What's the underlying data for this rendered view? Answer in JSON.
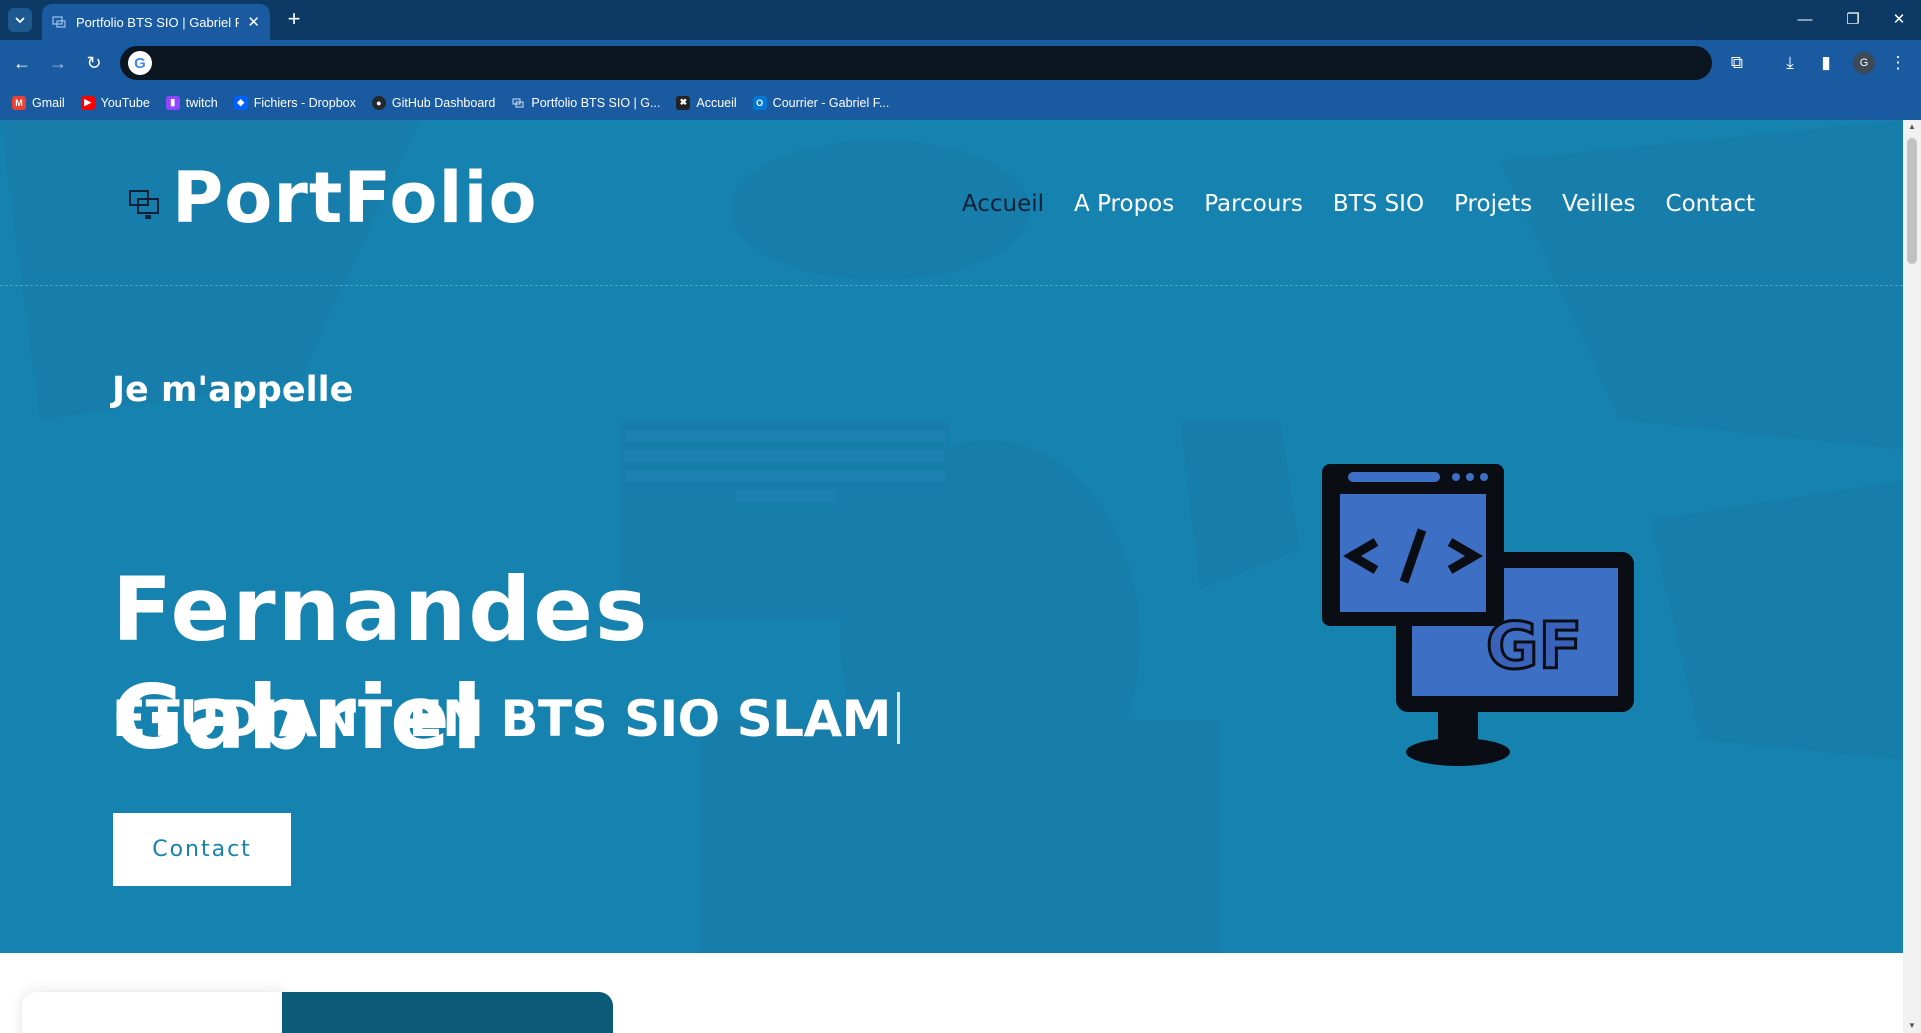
{
  "browser": {
    "tab_title": "Portfolio BTS SIO | Gabriel Fernandes",
    "new_tab": "+",
    "close_tab": "✕",
    "address": "",
    "profile_initial": "G",
    "bookmarks": [
      {
        "label": "Gmail",
        "icon": "gmail-icon",
        "color": "#ea4335"
      },
      {
        "label": "YouTube",
        "icon": "youtube-icon",
        "color": "#ff0000"
      },
      {
        "label": "twitch",
        "icon": "twitch-icon",
        "color": "#9146ff"
      },
      {
        "label": "Fichiers - Dropbox",
        "icon": "dropbox-icon",
        "color": "#0061fe"
      },
      {
        "label": "GitHub Dashboard",
        "icon": "github-icon",
        "color": "#24292f"
      },
      {
        "label": "Portfolio BTS SIO | G...",
        "icon": "portfolio-icon",
        "color": "#1a5aa0"
      },
      {
        "label": "Accueil",
        "icon": "accueil-icon",
        "color": "#222222"
      },
      {
        "label": "Courrier - Gabriel F...",
        "icon": "outlook-icon",
        "color": "#0078d4"
      }
    ]
  },
  "site": {
    "logo": "PortFolio",
    "nav": [
      "Accueil",
      "A Propos",
      "Parcours",
      "BTS SIO",
      "Projets",
      "Veilles",
      "Contact"
    ],
    "active_nav": "Accueil",
    "intro": "Je m'appelle",
    "name_line1": "Fernandes",
    "name_line2": "Gabriel",
    "role": "ÉTUDIANT EN BTS SIO SLAM",
    "cta": "Contact",
    "hero_bg": "#1582b0",
    "accent_dark": "#0b5a78"
  }
}
